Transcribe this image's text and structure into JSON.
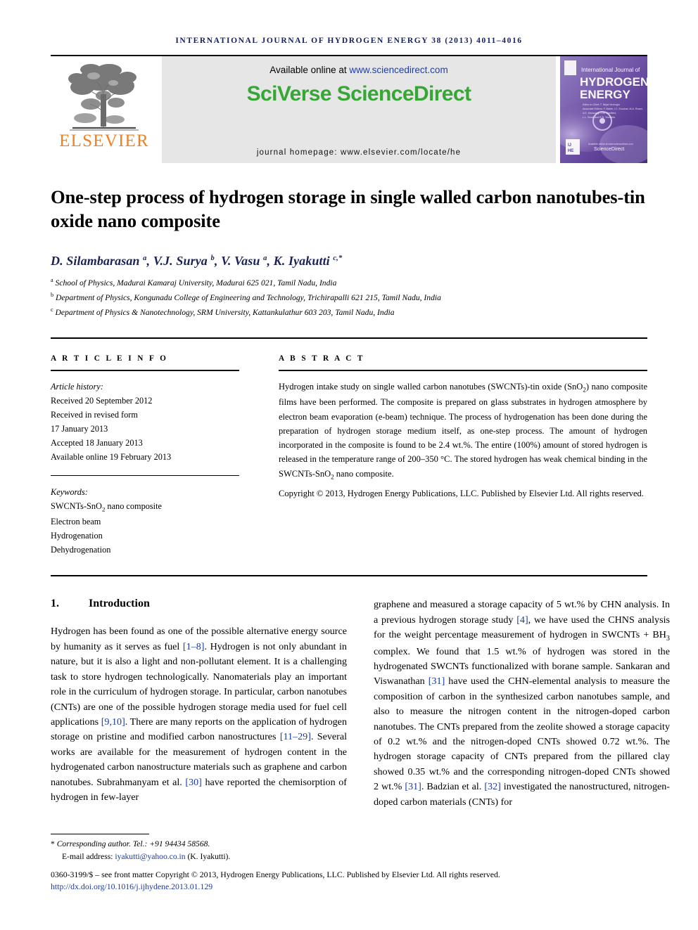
{
  "running_head": "INTERNATIONAL JOURNAL OF HYDROGEN ENERGY 38 (2013) 4011–4016",
  "header": {
    "publisher_name": "ELSEVIER",
    "publisher_logo_alt": "elsevier-tree-logo",
    "available_prefix": "Available online at ",
    "available_url": "www.sciencedirect.com",
    "platform_brand_1": "SciVerse",
    "platform_brand_2": "ScienceDirect",
    "journal_homepage": "journal homepage: www.elsevier.com/locate/he",
    "cover": {
      "line1": "International Journal of",
      "line2": "HYDROGEN",
      "line3": "ENERGY",
      "footer_brand": "ScienceDirect",
      "corner_mark": "IJHE"
    }
  },
  "article": {
    "title": "One-step process of hydrogen storage in single walled carbon nanotubes-tin oxide nano composite",
    "authors_html": "D. Silambarasan <sup>a</sup>, V.J. Surya <sup>b</sup>, V. Vasu <sup>a</sup>, K. Iyakutti <sup>c,*</sup>",
    "affiliations": [
      {
        "marker": "a",
        "text": "School of Physics, Madurai Kamaraj University, Madurai 625 021, Tamil Nadu, India"
      },
      {
        "marker": "b",
        "text": "Department of Physics, Kongunadu College of Engineering and Technology, Trichirapalli 621 215, Tamil Nadu, India"
      },
      {
        "marker": "c",
        "text": "Department of Physics & Nanotechnology, SRM University, Kattankulathur 603 203, Tamil Nadu, India"
      }
    ]
  },
  "article_info": {
    "label": "A R T I C L E  I N F O",
    "history_label": "Article history:",
    "history": [
      "Received 20 September 2012",
      "Received in revised form",
      "17 January 2013",
      "Accepted 18 January 2013",
      "Available online 19 February 2013"
    ],
    "keywords_label": "Keywords:",
    "keywords": [
      "SWCNTs-SnO2 nano composite",
      "Electron beam",
      "Hydrogenation",
      "Dehydrogenation"
    ]
  },
  "abstract": {
    "label": "A B S T R A C T",
    "text": "Hydrogen intake study on single walled carbon nanotubes (SWCNTs)-tin oxide (SnO2) nano composite films have been performed. The composite is prepared on glass substrates in hydrogen atmosphere by electron beam evaporation (e-beam) technique. The process of hydrogenation has been done during the preparation of hydrogen storage medium itself, as one-step process. The amount of hydrogen incorporated in the composite is found to be 2.4 wt.%. The entire (100%) amount of stored hydrogen is released in the temperature range of 200–350 °C. The stored hydrogen has weak chemical binding in the SWCNTs-SnO2 nano composite.",
    "copyright": "Copyright © 2013, Hydrogen Energy Publications, LLC. Published by Elsevier Ltd. All rights reserved."
  },
  "sections": {
    "intro_number": "1.",
    "intro_title": "Introduction",
    "left_column_paragraph": "Hydrogen has been found as one of the possible alternative energy source by humanity as it serves as fuel [1–8]. Hydrogen is not only abundant in nature, but it is also a light and non-pollutant element. It is a challenging task to store hydrogen technologically. Nanomaterials play an important role in the curriculum of hydrogen storage. In particular, carbon nanotubes (CNTs) are one of the possible hydrogen storage media used for fuel cell applications [9,10]. There are many reports on the application of hydrogen storage on pristine and modified carbon nanostructures [11–29]. Several works are available for the measurement of hydrogen content in the hydrogenated carbon nanostructure materials such as graphene and carbon nanotubes. Subrahmanyam et al. [30] have reported the chemisorption of hydrogen in few-layer",
    "right_column_paragraph": "graphene and measured a storage capacity of 5 wt.% by CHN analysis. In a previous hydrogen storage study [4], we have used the CHNS analysis for the weight percentage measurement of hydrogen in SWCNTs + BH3 complex. We found that 1.5 wt.% of hydrogen was stored in the hydrogenated SWCNTs functionalized with borane sample. Sankaran and Viswanathan [31] have used the CHN-elemental analysis to measure the composition of carbon in the synthesized carbon nanotubes sample, and also to measure the nitrogen content in the nitrogen-doped carbon nanotubes. The CNTs prepared from the zeolite showed a storage capacity of 0.2 wt.% and the nitrogen-doped CNTs showed 0.72 wt.%. The hydrogen storage capacity of CNTs prepared from the pillared clay showed 0.35 wt.% and the corresponding nitrogen-doped CNTs showed 2 wt.% [31]. Badzian et al. [32] investigated the nanostructured, nitrogen-doped carbon materials (CNTs) for"
  },
  "footnotes": {
    "corresponding": "Corresponding author. Tel.: +91 94434 58568.",
    "email_label": "E-mail address: ",
    "email": "iyakutti@yahoo.co.in",
    "email_suffix": " (K. Iyakutti).",
    "issn_line": "0360-3199/$ – see front matter Copyright © 2013, Hydrogen Energy Publications, LLC. Published by Elsevier Ltd. All rights reserved.",
    "doi": "http://dx.doi.org/10.1016/j.ijhydene.2013.01.129"
  },
  "colors": {
    "link_blue": "#1b3a9c",
    "running_head_navy": "#151e5c",
    "elsevier_orange": "#f08020",
    "sciencedirect_green": "#36a635",
    "band_gray": "#e6e6e6"
  }
}
